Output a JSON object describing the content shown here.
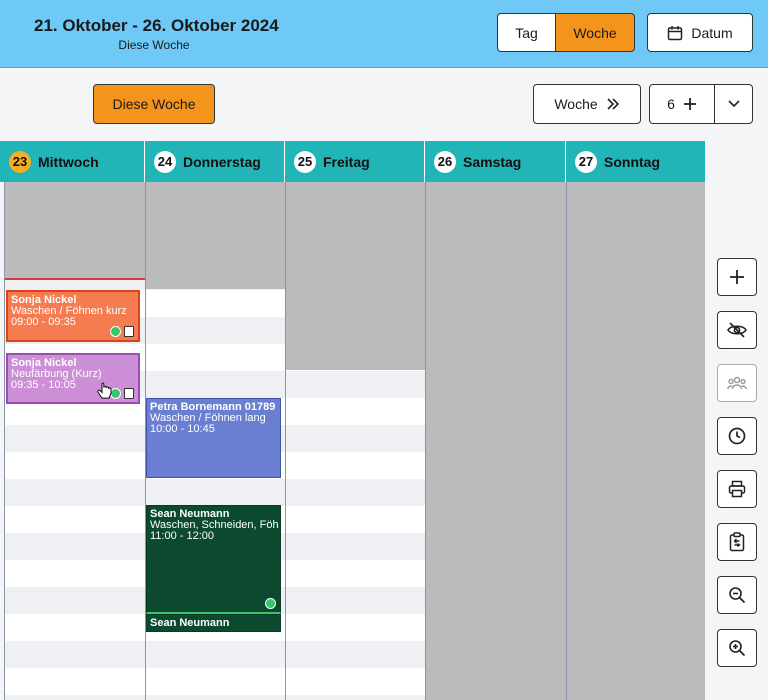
{
  "header": {
    "title": "21. Oktober - 26. Oktober 2024",
    "subtitle": "Diese Woche",
    "view_tag": "Tag",
    "view_woche": "Woche",
    "datum_label": "Datum"
  },
  "toolbar": {
    "this_week_label": "Diese Woche",
    "week_nav_label": "Woche",
    "count_value": "6"
  },
  "days": [
    {
      "num": "23",
      "name": "Mittwoch",
      "today": true
    },
    {
      "num": "24",
      "name": "Donnerstag"
    },
    {
      "num": "25",
      "name": "Freitag"
    },
    {
      "num": "26",
      "name": "Samstag"
    },
    {
      "num": "27",
      "name": "Sonntag"
    }
  ],
  "appointments": [
    {
      "name": "Sonja Nickel",
      "service": "Waschen / Föhnen kurz",
      "time": "09:00 - 09:35",
      "color": "#f47c50"
    },
    {
      "name": "Sonja Nickel",
      "service": "Neufärbung (Kurz)",
      "time": "09:35 - 10:05",
      "color": "#cc8fd6"
    },
    {
      "name": "Petra Bornemann  01789",
      "service": "Waschen / Föhnen lang",
      "time": "10:00 - 10:45",
      "color": "#6a7fd1"
    },
    {
      "name": "Sean Neumann",
      "service": "Waschen, Schneiden, Föh",
      "time": "11:00 - 12:00",
      "color": "#0b4a2f"
    },
    {
      "name": "Sean Neumann",
      "service": "",
      "time": "",
      "color": "#0b4a2f"
    }
  ],
  "side_tools": [
    "plus-icon",
    "eye-off-icon",
    "group-icon",
    "clock-icon",
    "printer-icon",
    "clipboard-icon",
    "zoom-out-icon",
    "zoom-in-icon"
  ]
}
